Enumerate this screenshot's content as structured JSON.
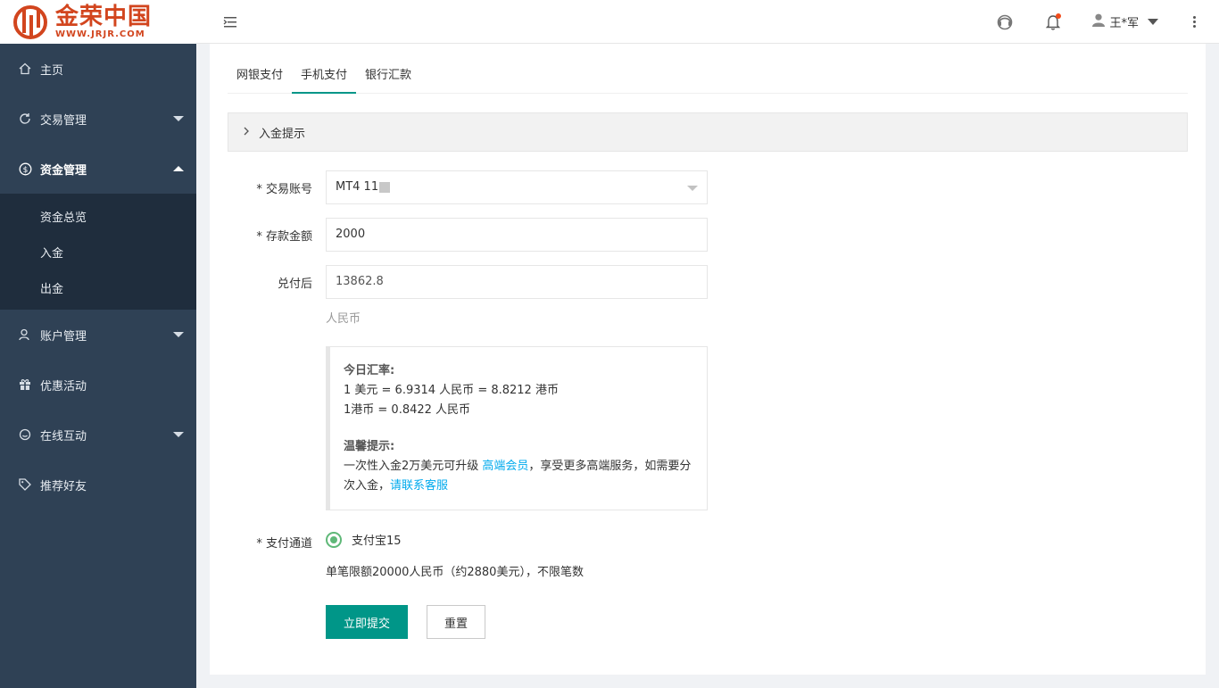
{
  "logo": {
    "name": "金荣中国",
    "url": "WWW.JRJR.COM"
  },
  "sidebar": {
    "items": [
      {
        "label": "主页",
        "icon": "home-icon"
      },
      {
        "label": "交易管理",
        "icon": "refresh-icon"
      },
      {
        "label": "资金管理",
        "icon": "dollar-icon"
      },
      {
        "label": "账户管理",
        "icon": "user-icon"
      },
      {
        "label": "优惠活动",
        "icon": "gift-icon"
      },
      {
        "label": "在线互动",
        "icon": "chat-icon"
      },
      {
        "label": "推荐好友",
        "icon": "tag-icon"
      }
    ],
    "sub_items": [
      "资金总览",
      "入金",
      "出金"
    ]
  },
  "header": {
    "user_name": "王*军"
  },
  "tabs": [
    "网银支付",
    "手机支付",
    "银行汇款"
  ],
  "collapse_title": "入金提示",
  "form": {
    "account_label": "* 交易账号",
    "account_value": "MT4 11",
    "amount_label": "* 存款金额",
    "amount_value": "2000",
    "converted_label": "兑付后",
    "converted_value": "13862.8",
    "converted_unit": "人民币",
    "channel_label": "* 支付通道",
    "channel_option": "支付宝15",
    "limit_text": "单笔限额20000人民币（约2880美元），不限笔数",
    "submit_label": "立即提交",
    "reset_label": "重置"
  },
  "note": {
    "rate_title": "今日汇率:",
    "rate_line1": "1 美元 = 6.9314 人民币 = 8.8212 港币",
    "rate_line2": "1港币 = 0.8422 人民币",
    "tip_title": "温馨提示:",
    "tip_text1": "一次性入金2万美元可升级 ",
    "tip_link1": "高端会员",
    "tip_text2": "，享受更多高端服务，如需要分次入金，",
    "tip_link2": "请联系客服"
  },
  "colors": {
    "sidebar_bg": "#2f4155",
    "submenu_bg": "#1f2d3d",
    "primary": "#009688",
    "link": "#01aaed",
    "radio": "#5fb878",
    "brand": "#d2451e"
  }
}
